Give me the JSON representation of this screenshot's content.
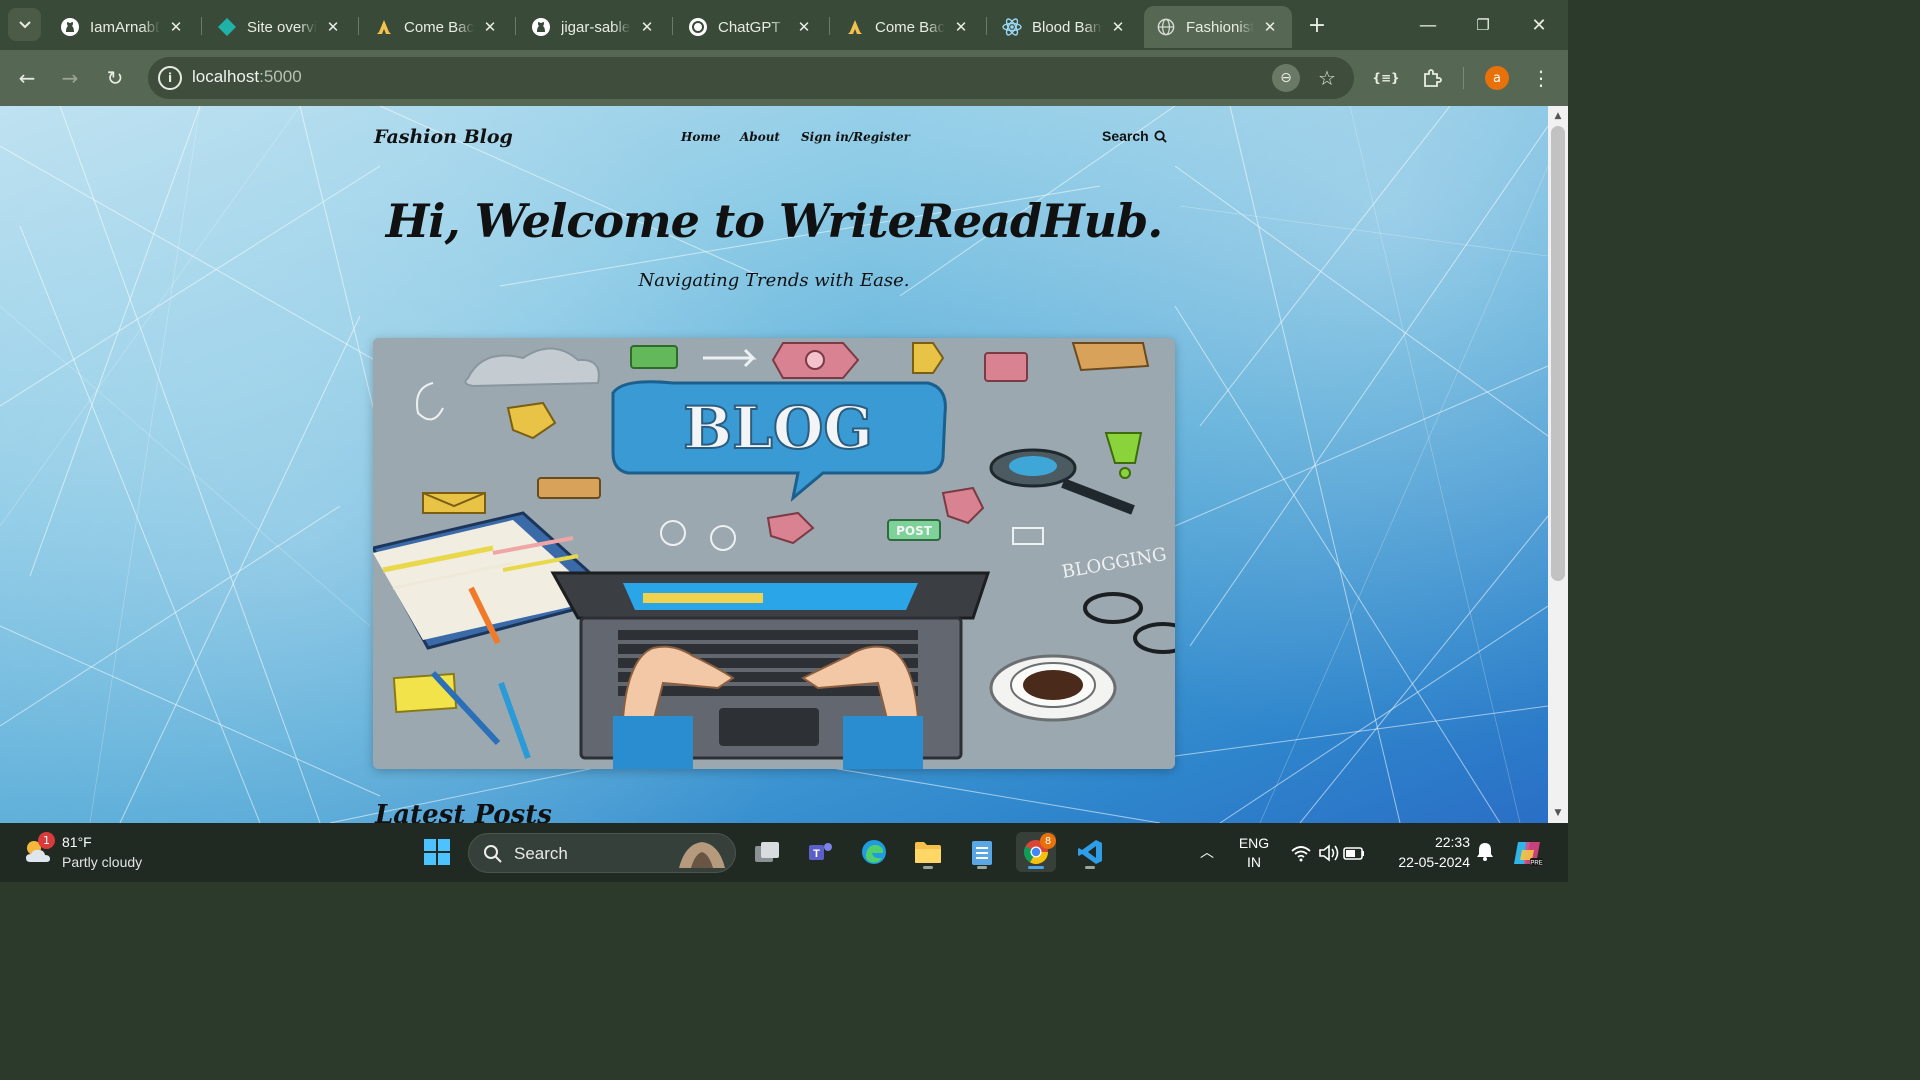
{
  "browser": {
    "tabs": [
      {
        "title": "IamArnabDas",
        "icon": "github-icon",
        "active": false
      },
      {
        "title": "Site overview",
        "icon": "netlify-icon",
        "active": false
      },
      {
        "title": "Come Back",
        "icon": "praying-hands-icon",
        "active": false
      },
      {
        "title": "jigar-sable",
        "icon": "github-icon",
        "active": false
      },
      {
        "title": "ChatGPT",
        "icon": "chatgpt-icon",
        "active": false
      },
      {
        "title": "Come Back",
        "icon": "praying-hands-icon",
        "active": false
      },
      {
        "title": "Blood Bank",
        "icon": "react-icon",
        "active": false
      },
      {
        "title": "Fashionista",
        "icon": "globe-icon",
        "active": true
      }
    ],
    "address": {
      "host": "localhost",
      "port": ":5000"
    },
    "profile_initial": "a"
  },
  "site": {
    "logo": "Fashion Blog",
    "nav": {
      "home": "Home",
      "about": "About",
      "signin": "Sign in/Register",
      "search": "Search"
    },
    "hero_title": "Hi, Welcome to WriteReadHub.",
    "hero_subtitle": "Navigating Trends with Ease.",
    "illustration": {
      "blog": "BLOG",
      "post": "POST",
      "blogging": "BLOGGING"
    },
    "section_title": "Latest Posts"
  },
  "taskbar": {
    "weather": {
      "temp": "81°F",
      "desc": "Partly cloudy",
      "badge": "1"
    },
    "search_label": "Search",
    "chrome_badge": "8",
    "language": {
      "line1": "ENG",
      "line2": "IN"
    },
    "time": "22:33",
    "date": "22-05-2024"
  },
  "colors": {
    "accent": "#4fa3e8",
    "tab_active": "#566753",
    "tab_strip": "#3a4a38",
    "profile": "#e8710a"
  }
}
